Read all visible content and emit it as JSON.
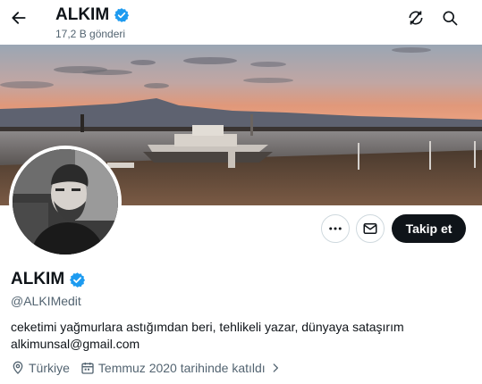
{
  "header": {
    "name": "ALKIM",
    "post_count": "17,2 B gönderi",
    "back_icon": "arrow-left-icon",
    "right_icons": [
      "retweet-off-icon",
      "search-icon"
    ]
  },
  "profile": {
    "display_name": "ALKIM",
    "handle": "@ALKIMedit",
    "verified": true,
    "bio_line1": "ceketimi yağmurlara astığımdan beri, tehlikeli yazar, dünyaya sataşırım",
    "bio_line2": "alkimunsal@gmail.com",
    "location": "Türkiye",
    "joined": "Temmuz 2020 tarihinde katıldı"
  },
  "actions": {
    "more_icon": "more-icon",
    "message_icon": "envelope-icon",
    "follow_label": "Takip et"
  },
  "colors": {
    "verified_blue": "#1d9bf0",
    "button_dark": "#0f1419",
    "secondary_text": "#536471"
  }
}
